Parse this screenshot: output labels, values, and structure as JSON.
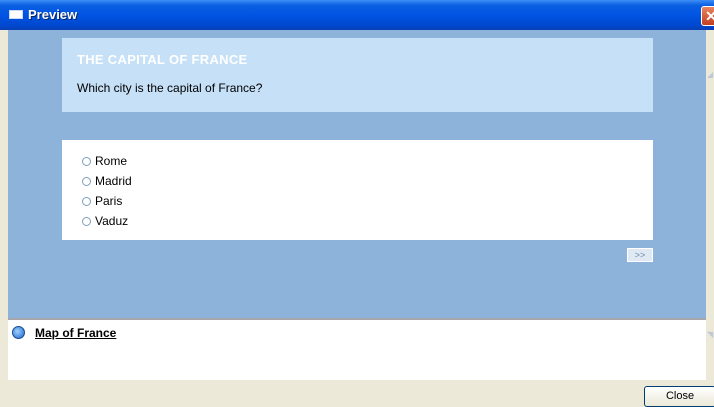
{
  "window": {
    "title": "Preview",
    "close_glyph": "✕"
  },
  "question": {
    "title": "THE CAPITAL OF FRANCE",
    "text": "Which city is the capital of France?"
  },
  "answers": [
    {
      "label": "Rome",
      "selected": false
    },
    {
      "label": "Madrid",
      "selected": false
    },
    {
      "label": "Paris",
      "selected": false
    },
    {
      "label": "Vaduz",
      "selected": false
    }
  ],
  "navigation": {
    "next_label": ">>"
  },
  "links": {
    "items": [
      {
        "label": "Map of France",
        "icon": "document-link-icon"
      }
    ]
  },
  "footer": {
    "close_label": "Close"
  },
  "colors": {
    "titlebar": "#0054e3",
    "preview_bg": "#8db3da",
    "header_bg": "#c6e0f7"
  }
}
